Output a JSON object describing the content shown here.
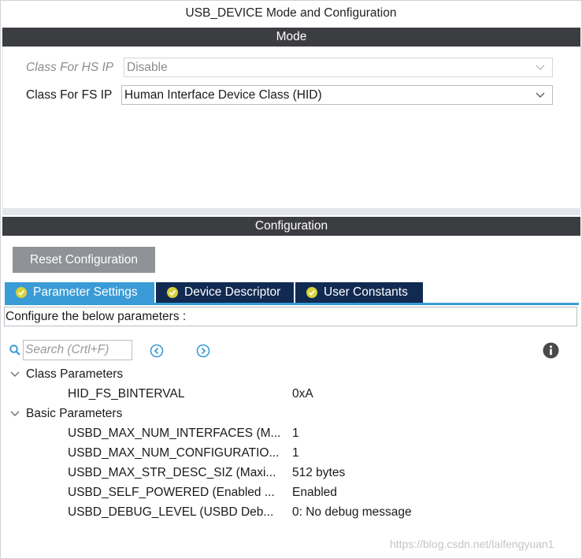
{
  "header": {
    "title": "USB_DEVICE Mode and Configuration"
  },
  "mode": {
    "section_title": "Mode",
    "fields": [
      {
        "label": "Class For HS IP",
        "value": "Disable",
        "enabled": false
      },
      {
        "label": "Class For FS IP",
        "value": "Human Interface Device Class (HID)",
        "enabled": true
      }
    ]
  },
  "configuration": {
    "section_title": "Configuration",
    "reset_label": "Reset Configuration",
    "tabs": [
      {
        "label": "Parameter Settings",
        "active": true
      },
      {
        "label": "Device Descriptor",
        "active": false
      },
      {
        "label": "User Constants",
        "active": false
      }
    ],
    "description": "Configure the below parameters :",
    "search": {
      "placeholder": "Search (Crtl+F)",
      "value": ""
    },
    "groups": [
      {
        "label": "Class Parameters",
        "params": [
          {
            "name": "HID_FS_BINTERVAL",
            "value": "0xA"
          }
        ]
      },
      {
        "label": "Basic Parameters",
        "params": [
          {
            "name": "USBD_MAX_NUM_INTERFACES (M...",
            "value": "1"
          },
          {
            "name": "USBD_MAX_NUM_CONFIGURATIO...",
            "value": "1"
          },
          {
            "name": "USBD_MAX_STR_DESC_SIZ (Maxi...",
            "value": "512 bytes"
          },
          {
            "name": "USBD_SELF_POWERED (Enabled ...",
            "value": "Enabled"
          },
          {
            "name": "USBD_DEBUG_LEVEL (USBD Deb...",
            "value": "0: No debug message"
          }
        ]
      }
    ]
  },
  "icons": {
    "search": "search-icon",
    "previous": "previous-circle-icon",
    "next": "next-circle-icon",
    "info": "info-icon",
    "tab_check": "check-circle-icon",
    "dropdown": "chevron-down-icon",
    "tree_expand": "chevron-down-icon"
  },
  "colors": {
    "section_bar": "#3c3d40",
    "tab_active": "#3a9bd6",
    "tab_inactive": "#102a52",
    "reset_button": "#8f9296",
    "accent_icon": "#3a9bd6"
  },
  "watermark": "https://blog.csdn.net/laifengyuan1"
}
